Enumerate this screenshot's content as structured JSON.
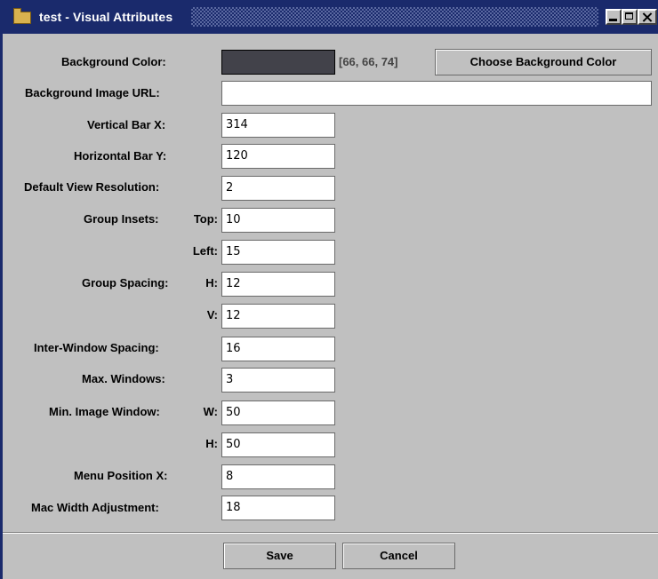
{
  "window": {
    "title": "test - Visual Attributes"
  },
  "form": {
    "background_color": {
      "label": "Background Color:",
      "swatch_color": "#42424a",
      "rgb_text": "[66, 66, 74]",
      "choose_button": "Choose Background Color"
    },
    "background_image_url": {
      "label": "Background Image URL:",
      "value": ""
    },
    "vertical_bar_x": {
      "label": "Vertical Bar X:",
      "value": "314"
    },
    "horizontal_bar_y": {
      "label": "Horizontal Bar Y:",
      "value": "120"
    },
    "default_view_resolution": {
      "label": "Default View Resolution:",
      "value": "2"
    },
    "group_insets": {
      "label": "Group Insets:",
      "top_label": "Top:",
      "top_value": "10",
      "left_label": "Left:",
      "left_value": "15"
    },
    "group_spacing": {
      "label": "Group Spacing:",
      "h_label": "H:",
      "h_value": "12",
      "v_label": "V:",
      "v_value": "12"
    },
    "inter_window_spacing": {
      "label": "Inter-Window Spacing:",
      "value": "16"
    },
    "max_windows": {
      "label": "Max. Windows:",
      "value": "3"
    },
    "min_image_window": {
      "label": "Min. Image Window:",
      "w_label": "W:",
      "w_value": "50",
      "h_label": "H:",
      "h_value": "50"
    },
    "menu_position_x": {
      "label": "Menu Position X:",
      "value": "8"
    },
    "mac_width_adjustment": {
      "label": "Mac Width Adjustment:",
      "value": "18"
    }
  },
  "buttons": {
    "save": "Save",
    "cancel": "Cancel"
  },
  "colors": {
    "title_bar": "#1a2a6c",
    "panel": "#c0c0c0"
  }
}
